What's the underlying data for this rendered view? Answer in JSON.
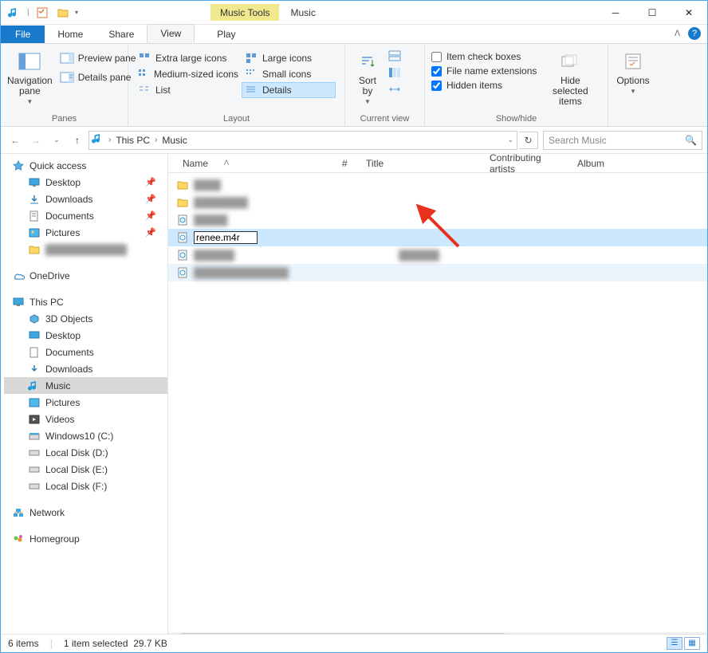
{
  "titlebar": {
    "context_tab": "Music Tools",
    "title": "Music"
  },
  "tabs": {
    "file": "File",
    "home": "Home",
    "share": "Share",
    "view": "View",
    "play": "Play"
  },
  "ribbon": {
    "panes": {
      "label": "Panes",
      "nav_pane": "Navigation\npane",
      "preview": "Preview pane",
      "details": "Details pane"
    },
    "layout": {
      "label": "Layout",
      "xl_icons": "Extra large icons",
      "large_icons": "Large icons",
      "med_icons": "Medium-sized icons",
      "small_icons": "Small icons",
      "list": "List",
      "details": "Details"
    },
    "current_view": {
      "label": "Current view",
      "sort_by": "Sort\nby"
    },
    "show_hide": {
      "label": "Show/hide",
      "item_check": "Item check boxes",
      "file_ext": "File name extensions",
      "hidden": "Hidden items",
      "hide_selected": "Hide selected\nitems"
    },
    "options": "Options"
  },
  "breadcrumb": {
    "this_pc": "This PC",
    "music": "Music"
  },
  "search": {
    "placeholder": "Search Music"
  },
  "columns": {
    "name": "Name",
    "num": "#",
    "title": "Title",
    "contrib": "Contributing artists",
    "album": "Album"
  },
  "nav": {
    "quick_access": "Quick access",
    "desktop": "Desktop",
    "downloads": "Downloads",
    "documents": "Documents",
    "pictures": "Pictures",
    "onedrive": "OneDrive",
    "this_pc": "This PC",
    "objects3d": "3D Objects",
    "desktop2": "Desktop",
    "documents2": "Documents",
    "downloads2": "Downloads",
    "music": "Music",
    "pictures2": "Pictures",
    "videos": "Videos",
    "win10": "Windows10 (C:)",
    "ld": "Local Disk (D:)",
    "le": "Local Disk (E:)",
    "lf": "Local Disk (F:)",
    "network": "Network",
    "homegroup": "Homegroup"
  },
  "rename_value": "renee.m4r",
  "status": {
    "items": "6 items",
    "selected": "1 item selected",
    "size": "29.7 KB"
  }
}
